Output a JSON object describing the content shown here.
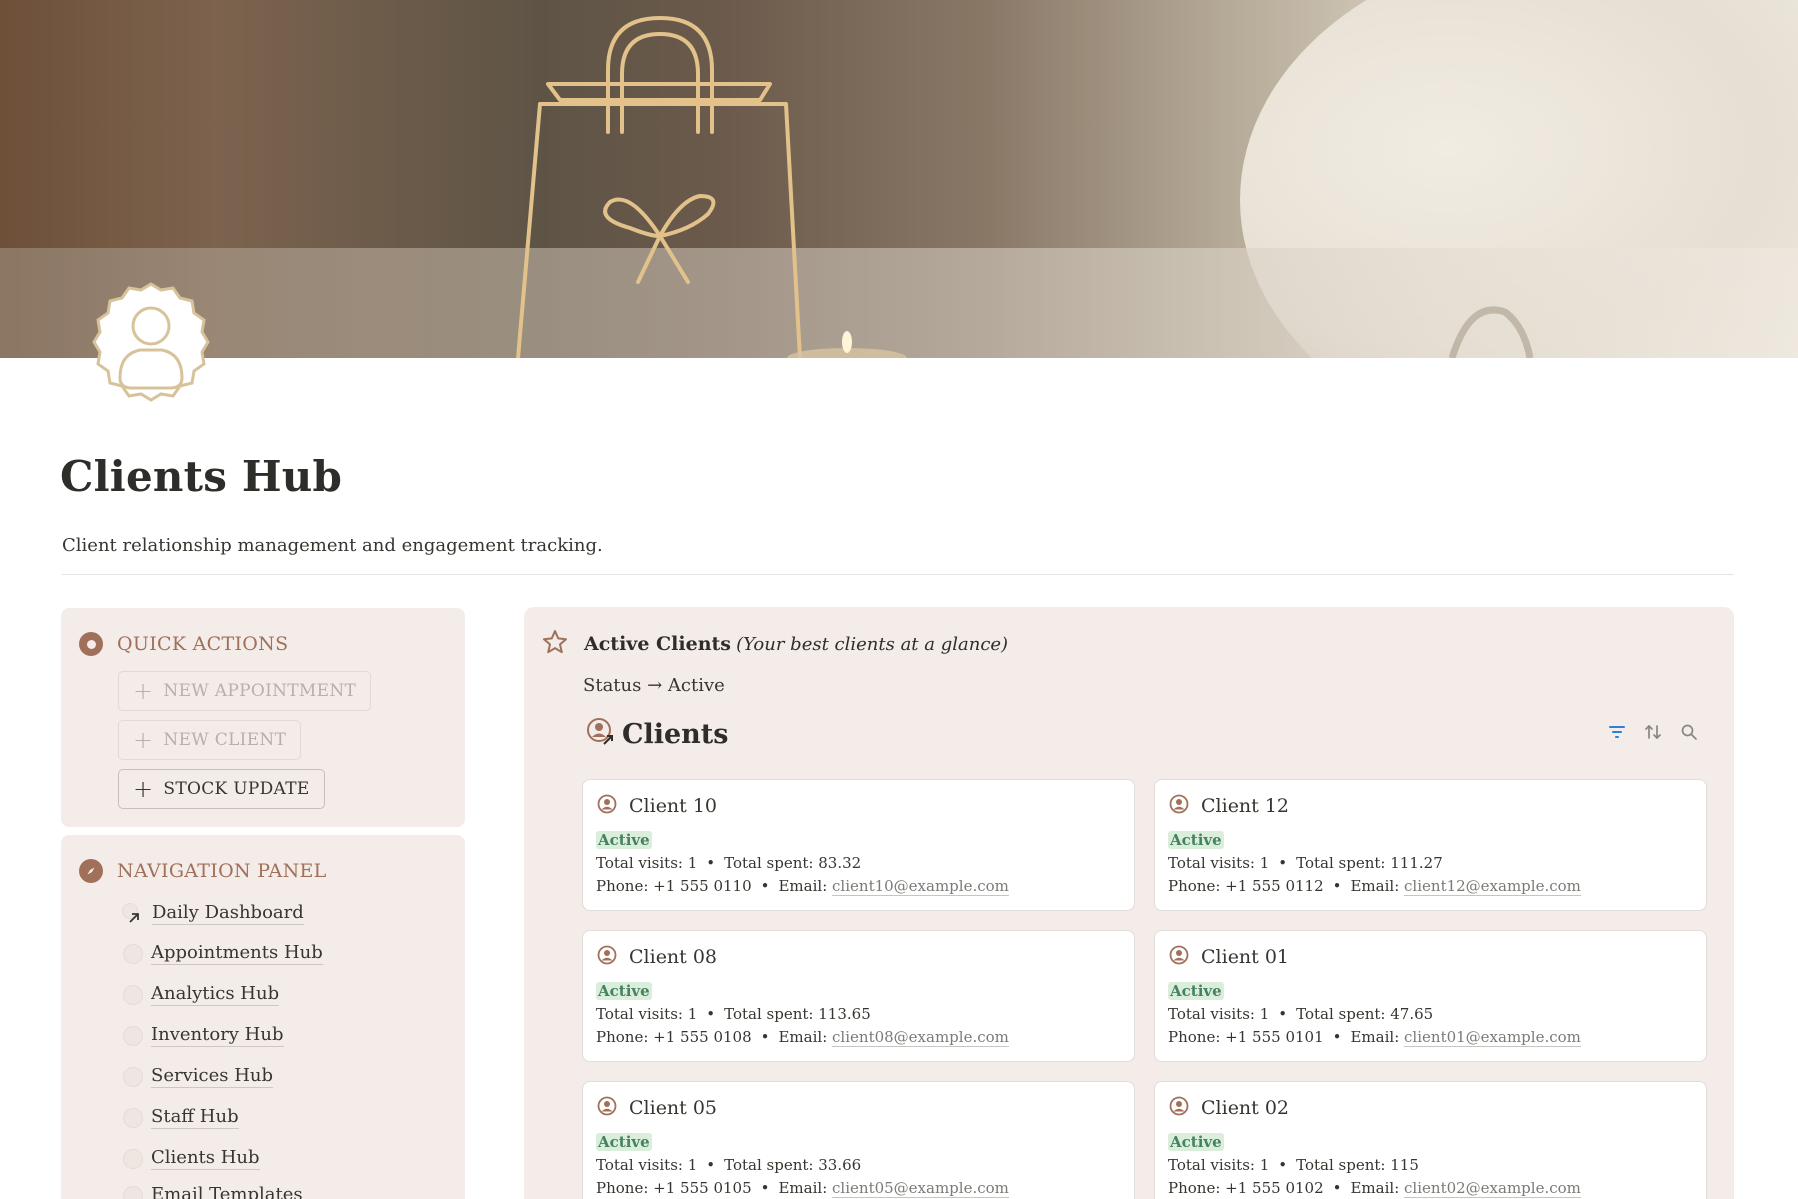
{
  "page": {
    "title": "Clients Hub",
    "subtitle": "Client relationship management and engagement tracking."
  },
  "quick_actions": {
    "title": "QUICK ACTIONS",
    "buttons": [
      {
        "label": "NEW APPOINTMENT",
        "state": "disabled"
      },
      {
        "label": "NEW CLIENT",
        "state": "disabled"
      },
      {
        "label": "STOCK UPDATE",
        "state": "enabled"
      }
    ]
  },
  "navigation": {
    "title": "NAVIGATION PANEL",
    "items": [
      {
        "label": "Daily Dashboard"
      },
      {
        "label": "Appointments Hub"
      },
      {
        "label": "Analytics Hub"
      },
      {
        "label": "Inventory Hub"
      },
      {
        "label": "Services Hub"
      },
      {
        "label": "Staff Hub"
      },
      {
        "label": "Clients Hub"
      },
      {
        "label": "Email Templates"
      }
    ]
  },
  "active_clients": {
    "title": "Active Clients",
    "subtitle": "(Your best clients at a glance)",
    "filter": "Status → Active",
    "database_title": "Clients"
  },
  "labels": {
    "visits": "Total visits:",
    "spent": "Total spent:",
    "phone": "Phone:",
    "email": "Email:",
    "dot": "•"
  },
  "clients": [
    {
      "name": "Client 10",
      "status": "Active",
      "visits": "1",
      "spent": "83.32",
      "phone": "+1 555 0110",
      "email": "client10@example.com"
    },
    {
      "name": "Client 12",
      "status": "Active",
      "visits": "1",
      "spent": "111.27",
      "phone": "+1 555 0112",
      "email": "client12@example.com"
    },
    {
      "name": "Client 08",
      "status": "Active",
      "visits": "1",
      "spent": "113.65",
      "phone": "+1 555 0108",
      "email": "client08@example.com"
    },
    {
      "name": "Client 01",
      "status": "Active",
      "visits": "1",
      "spent": "47.65",
      "phone": "+1 555 0101",
      "email": "client01@example.com"
    },
    {
      "name": "Client 05",
      "status": "Active",
      "visits": "1",
      "spent": "33.66",
      "phone": "+1 555 0105",
      "email": "client05@example.com"
    },
    {
      "name": "Client 02",
      "status": "Active",
      "visits": "1",
      "spent": "115",
      "phone": "+1 555 0102",
      "email": "client02@example.com"
    }
  ],
  "colors": {
    "accent": "#a1705a",
    "panel_bg": "#f3ece9",
    "status_green": "#448361",
    "status_bg": "#dbeddb",
    "toolbar_blue": "#2e7fd6"
  }
}
